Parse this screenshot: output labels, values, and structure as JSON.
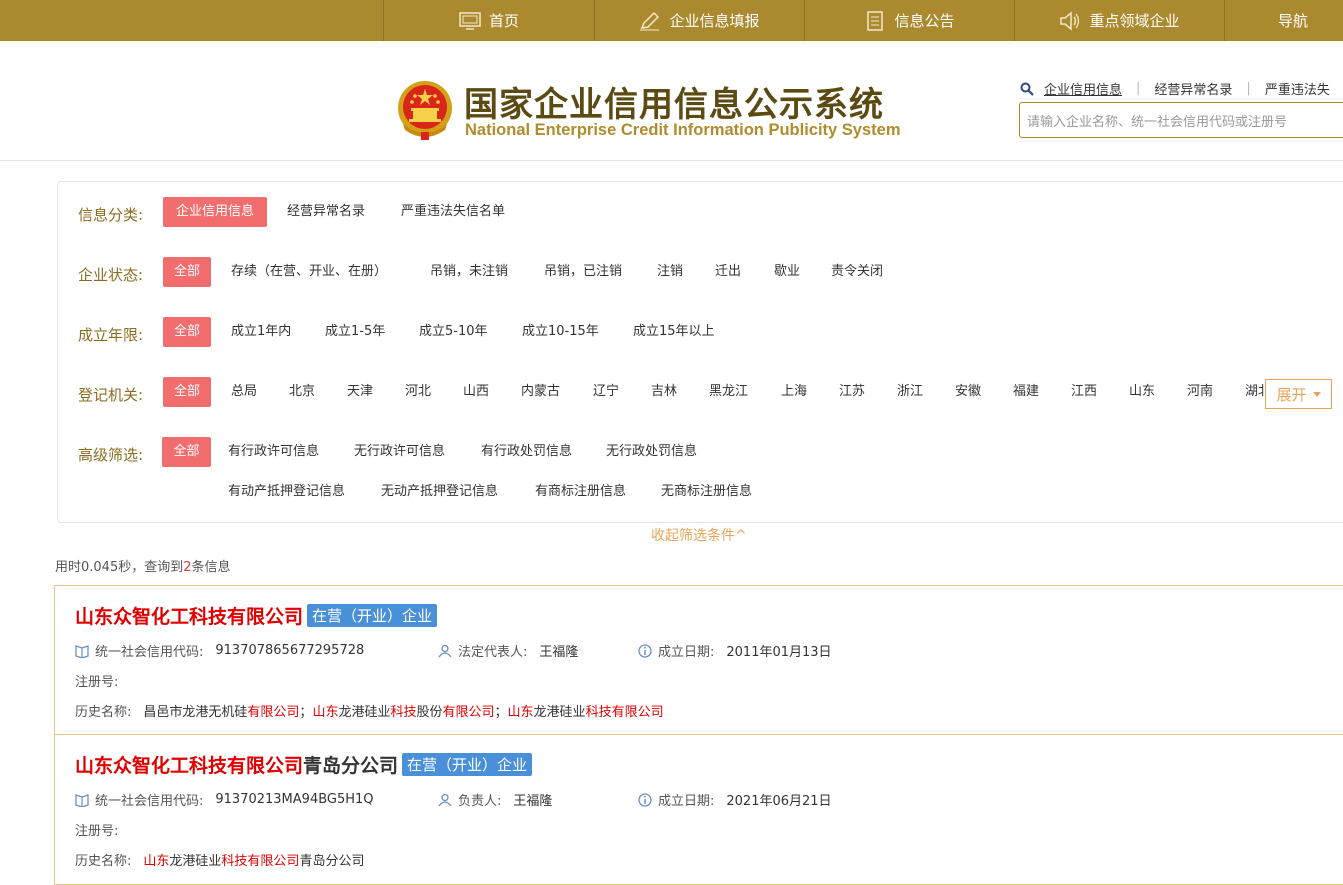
{
  "nav": {
    "items": [
      {
        "label": "首页",
        "icon": "monitor-icon"
      },
      {
        "label": "企业信息填报",
        "icon": "pen-icon"
      },
      {
        "label": "信息公告",
        "icon": "document-icon"
      },
      {
        "label": "重点领域企业",
        "icon": "speaker-icon"
      },
      {
        "label": "导航",
        "icon": ""
      }
    ]
  },
  "header": {
    "title": "国家企业信用信息公示系统",
    "subtitle": "National Enterprise Credit Information Publicity System",
    "search_tabs": [
      "企业信用信息",
      "经营异常名录",
      "严重违法失"
    ],
    "search_placeholder": "请输入企业名称、统一社会信用代码或注册号"
  },
  "filters": {
    "category": {
      "label": "信息分类:",
      "options": [
        "企业信用信息",
        "经营异常名录",
        "严重违法失信名单"
      ],
      "selected": 0
    },
    "status": {
      "label": "企业状态:",
      "options": [
        "全部",
        "存续（在营、开业、在册）",
        "吊销，未注销",
        "吊销，已注销",
        "注销",
        "迁出",
        "歇业",
        "责令关闭"
      ],
      "selected": 0
    },
    "age": {
      "label": "成立年限:",
      "options": [
        "全部",
        "成立1年内",
        "成立1-5年",
        "成立5-10年",
        "成立10-15年",
        "成立15年以上"
      ],
      "selected": 0
    },
    "authority": {
      "label": "登记机关:",
      "options": [
        "全部",
        "总局",
        "北京",
        "天津",
        "河北",
        "山西",
        "内蒙古",
        "辽宁",
        "吉林",
        "黑龙江",
        "上海",
        "江苏",
        "浙江",
        "安徽",
        "福建",
        "江西",
        "山东",
        "河南",
        "湖北"
      ],
      "selected": 0
    },
    "advanced": {
      "label": "高级筛选:",
      "options": [
        "全部",
        "有行政许可信息",
        "无行政许可信息",
        "有行政处罚信息",
        "无行政处罚信息",
        "有动产抵押登记信息",
        "无动产抵押登记信息",
        "有商标注册信息",
        "无商标注册信息"
      ],
      "selected": 0
    },
    "expand_label": "展开",
    "collapse_label": "收起筛选条件^"
  },
  "stats": {
    "prefix": "用时0.045秒，查询到",
    "count": "2",
    "suffix": "条信息"
  },
  "results": [
    {
      "name_red": "山东众智化工科技有限公司",
      "name_rest": "",
      "status": "在营（开业）企业",
      "code_label": "统一社会信用代码:",
      "code": "913707865677295728",
      "rep_label": "法定代表人:",
      "rep": "王福隆",
      "date_label": "成立日期:",
      "date": "2011年01月13日",
      "reg_label": "注册号:",
      "reg": "",
      "history_label": "历史名称:",
      "history": [
        {
          "t": "昌邑市龙港无机硅",
          "h": false
        },
        {
          "t": "有限公司",
          "h": true
        },
        {
          "t": "；",
          "h": false
        },
        {
          "t": "山东",
          "h": true
        },
        {
          "t": "龙港硅业",
          "h": false
        },
        {
          "t": "科技",
          "h": true
        },
        {
          "t": "股份",
          "h": false
        },
        {
          "t": "有限公司",
          "h": true
        },
        {
          "t": "；",
          "h": false
        },
        {
          "t": "山东",
          "h": true
        },
        {
          "t": "龙港硅业",
          "h": false
        },
        {
          "t": "科技有限公司",
          "h": true
        }
      ]
    },
    {
      "name_red": "山东众智化工科技有限公司",
      "name_rest": "青岛分公司",
      "status": "在营（开业）企业",
      "code_label": "统一社会信用代码:",
      "code": "91370213MA94BG5H1Q",
      "rep_label": "负责人:",
      "rep": "王福隆",
      "date_label": "成立日期:",
      "date": "2021年06月21日",
      "reg_label": "注册号:",
      "reg": "",
      "history_label": "历史名称:",
      "history": [
        {
          "t": "山东",
          "h": true
        },
        {
          "t": "龙港硅业",
          "h": false
        },
        {
          "t": "科技有限公司",
          "h": true
        },
        {
          "t": "青岛分公司",
          "h": false
        }
      ]
    }
  ]
}
